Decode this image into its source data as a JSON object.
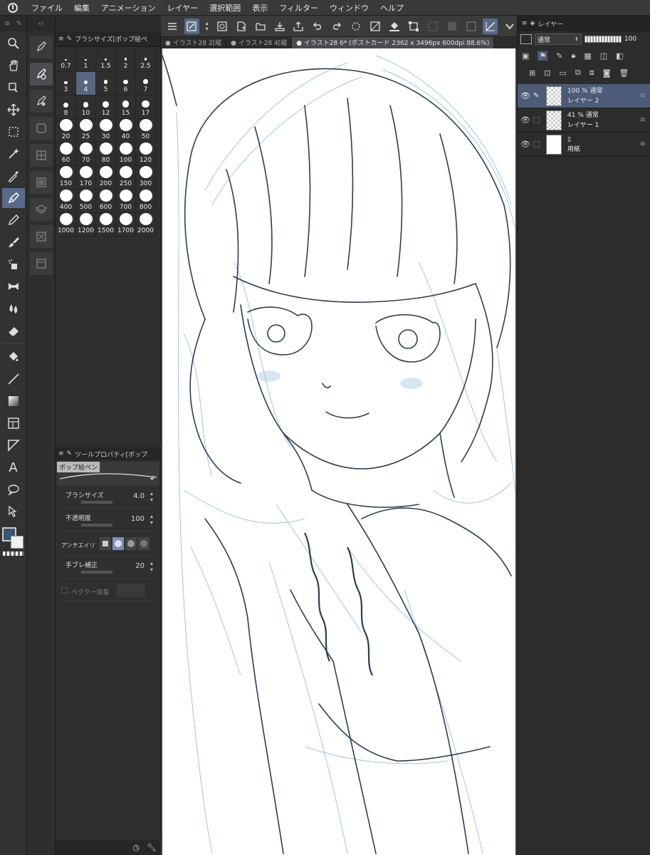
{
  "menu": [
    "ファイル",
    "編集",
    "アニメーション",
    "レイヤー",
    "選択範囲",
    "表示",
    "フィルター",
    "ウィンドウ",
    "ヘルプ"
  ],
  "brush_panel": {
    "title": "ブラシサイズ[ポップ絵ペ",
    "sizes": [
      "0.7",
      "1",
      "1.5",
      "2",
      "2.5",
      "3",
      "4",
      "5",
      "6",
      "7",
      "8",
      "10",
      "12",
      "15",
      "17",
      "20",
      "25",
      "30",
      "40",
      "50",
      "60",
      "70",
      "80",
      "100",
      "120",
      "150",
      "170",
      "200",
      "250",
      "300",
      "400",
      "500",
      "600",
      "700",
      "800",
      "1000",
      "1200",
      "1500",
      "1700",
      "2000"
    ],
    "selected": "4"
  },
  "tool_property": {
    "title": "ツールプロパティ[ポップ",
    "preset_name": "ポップ絵ペン",
    "brush_size_label": "ブラシサイズ",
    "brush_size_value": "4.0",
    "opacity_label": "不透明度",
    "opacity_value": "100",
    "antialias_label": "アンチエイリ",
    "stabilizer_label": "手ブレ補正",
    "stabilizer_value": "20",
    "vector_label": "ベクター吸着"
  },
  "tabs": [
    {
      "label": "イラスト28 2[縦"
    },
    {
      "label": "イラスト28 4[縦"
    },
    {
      "label": "イラスト28 6* (ポストカード 2362 x 3496px 600dpi 88.6%)",
      "active": true
    }
  ],
  "layers_panel": {
    "title": "レイヤー",
    "blend_mode": "通常",
    "opacity": "100",
    "layers": [
      {
        "line1": "100 % 通常",
        "line2": "レイヤー 2",
        "selected": true
      },
      {
        "line1": "41 % 通常",
        "line2": "レイヤー 1",
        "selected": false
      },
      {
        "line1": "",
        "line2": "用紙",
        "selected": false
      }
    ]
  },
  "colors": {
    "accent": "#5a6a8a",
    "main_color": "#3a5670",
    "sub_color": "#f2f2f2",
    "sketch_blue": "#8fb8d8",
    "line_dark": "#2c3e50"
  }
}
